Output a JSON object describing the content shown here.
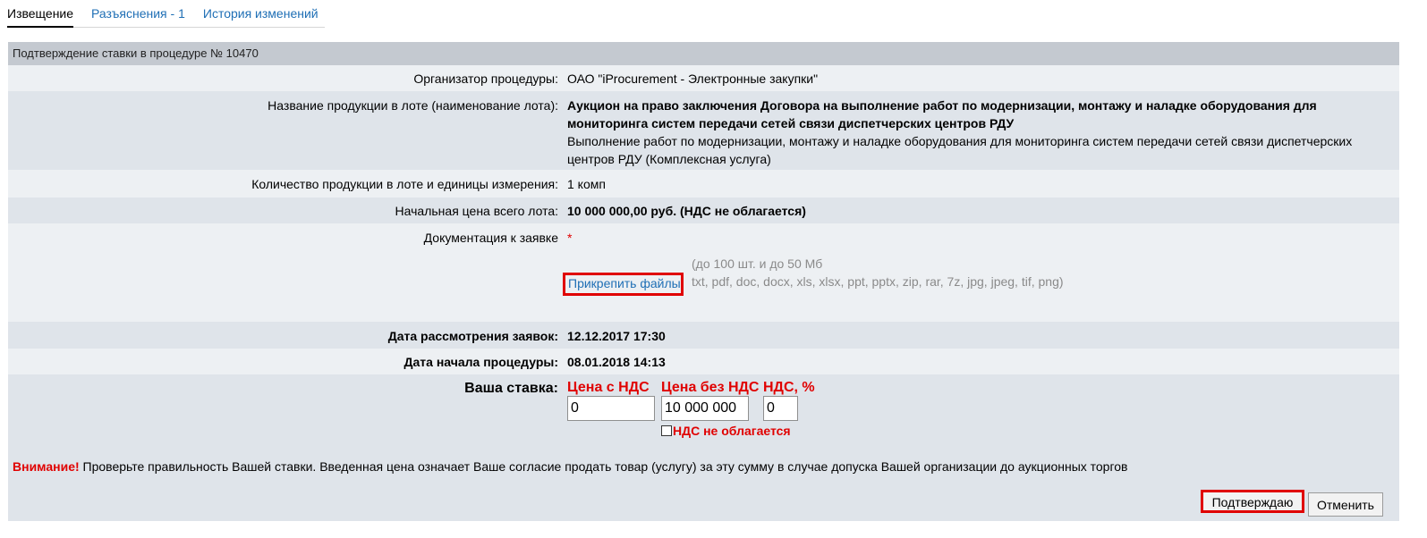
{
  "tabs": [
    {
      "label": "Извещение",
      "active": true
    },
    {
      "label": "Разъяснения - 1",
      "active": false
    },
    {
      "label": "История изменений",
      "active": false
    }
  ],
  "panel": {
    "header": "Подтверждение ставки в процедуре № 10470"
  },
  "fields": {
    "organizer_label": "Организатор процедуры:",
    "organizer_value": "ОАО \"iProcurement - Электронные закупки\"",
    "lot_label": "Название продукции в лоте (наименование лота):",
    "lot_title_line1": "Аукцион на право заключения Договора на выполнение работ по модернизации, монтажу и наладке оборудования для",
    "lot_title_line2": "мониторинга систем передачи сетей связи диспетчерских центров РДУ",
    "lot_desc_line1": "Выполнение работ по модернизации, монтажу и наладке оборудования для мониторинга систем передачи сетей связи диспетчерских",
    "lot_desc_line2": "центров РДУ (Комплексная услуга)",
    "quantity_label": "Количество продукции в лоте и единицы измерения:",
    "quantity_value": "1 комп",
    "price_label": "Начальная цена всего лота:",
    "price_value": "10 000 000,00 руб. (НДС не облагается)",
    "docs_label": "Документация к заявке",
    "docs_required": "*",
    "attach_link": "Прикрепить файлы",
    "attach_hint1": "(до 100 шт. и до 50 Мб",
    "attach_hint2": "txt, pdf, doc, docx, xls, xlsx, ppt, pptx, zip, rar, 7z, jpg, jpeg, tif, png)",
    "review_label": "Дата рассмотрения заявок:",
    "review_value": "12.12.2017 17:30",
    "start_label": "Дата начала процедуры:",
    "start_value": "08.01.2018 14:13"
  },
  "bid": {
    "label": "Ваша ставка:",
    "col_with_vat": "Цена с НДС",
    "col_without_vat": "Цена без НДС",
    "col_vat_percent": "НДС, %",
    "value_with_vat": "0",
    "value_without_vat": "10 000 000",
    "value_vat_percent": "0",
    "no_vat_checkbox_label": "НДС не облагается",
    "no_vat_checked": false
  },
  "warning": {
    "strong": "Внимание!",
    "text": " Проверьте правильность Вашей ставки. Введенная цена означает Ваше согласие продать товар (услугу) за эту сумму в случае допуска Вашей организации до аукционных торгов"
  },
  "buttons": {
    "confirm": "Подтверждаю",
    "cancel": "Отменить"
  }
}
